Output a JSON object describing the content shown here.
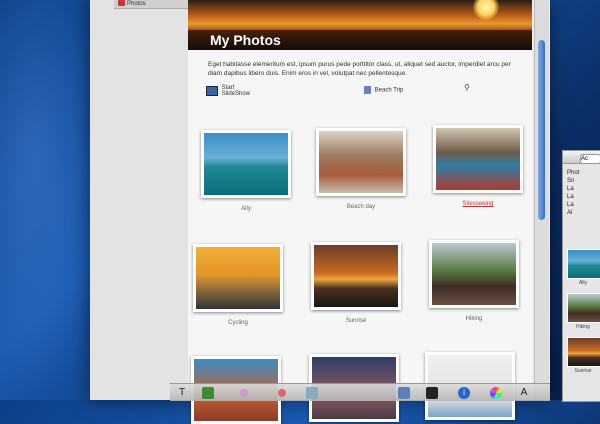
{
  "window": {
    "title": "Photos"
  },
  "banner": {
    "title": "My Photos"
  },
  "description": "Eget habitasse elementum est, ipsum purus pede porttitor class, ut, aliquet sed auctor, imperdiet arcu per diam dapibus libero duis. Enim eros in vel, volutpat nec pellentesque.",
  "toolbar": {
    "slideshow_label": "Start SlideShow",
    "beach_label": "Beach Trip"
  },
  "photos": [
    {
      "caption": "Ally"
    },
    {
      "caption": "Beach day"
    },
    {
      "caption": "Sitesseeing"
    },
    {
      "caption": "Cycling"
    },
    {
      "caption": "Sunrise"
    },
    {
      "caption": "Hiking"
    }
  ],
  "palette": {
    "button": "Ac",
    "tree": [
      "Phot",
      "Sn",
      "La",
      "La",
      "La",
      "Al"
    ],
    "thumbs": [
      {
        "caption": "Ally"
      },
      {
        "caption": "Hiking"
      },
      {
        "caption": "Sunrise"
      }
    ]
  },
  "dock_icons": [
    "T",
    "A"
  ]
}
